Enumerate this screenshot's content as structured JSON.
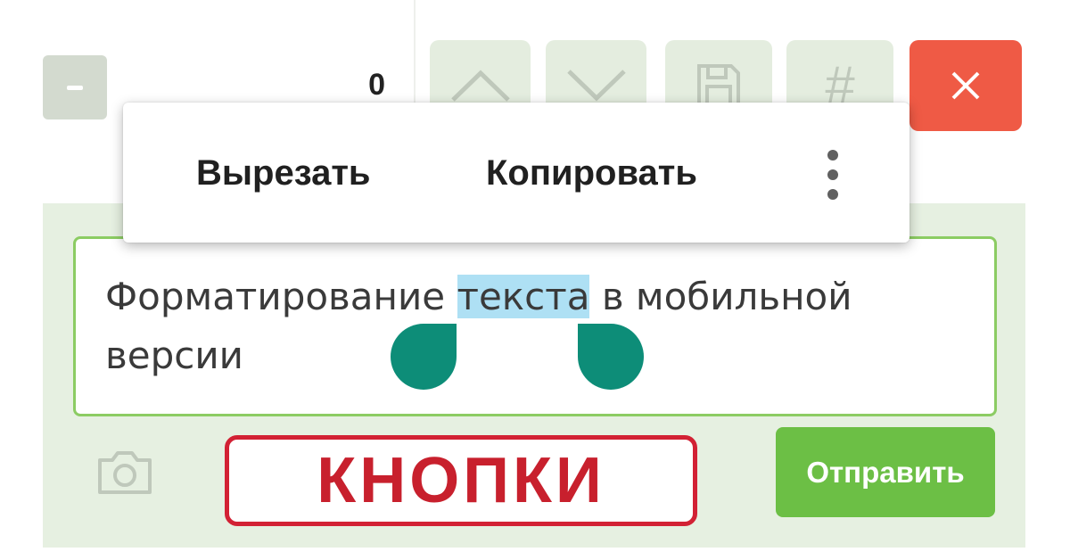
{
  "counter": {
    "value": "0"
  },
  "toolbar": {
    "up_icon": "chevron-up-icon",
    "down_icon": "chevron-down-icon",
    "save_icon": "floppy-disk-icon",
    "hash_label": "#",
    "close_icon": "close-icon"
  },
  "context_menu": {
    "cut_label": "Вырезать",
    "copy_label": "Копировать",
    "more_icon": "more-vertical-icon"
  },
  "editor": {
    "text_before": "Форматирование ",
    "selected_text": "текста",
    "text_after": " в мобильной версии"
  },
  "bottom": {
    "camera_icon": "camera-icon",
    "buttons_caption": "КНОПКИ",
    "send_label": "Отправить"
  },
  "colors": {
    "accent_green": "#6cbf45",
    "close_red": "#ef5a45",
    "handle_teal": "#0d8d78",
    "selection_blue": "#aee0f4",
    "caption_red": "#c8202d"
  }
}
